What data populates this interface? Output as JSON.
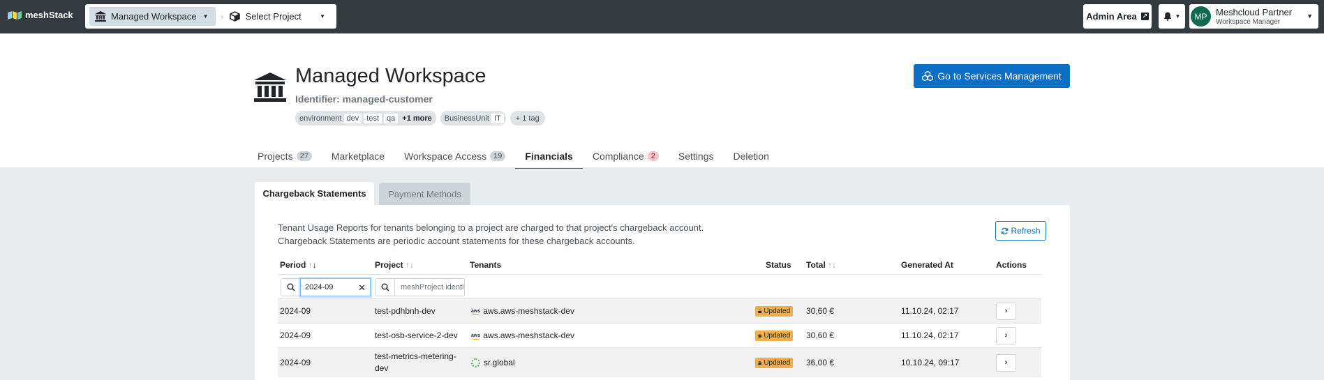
{
  "topbar": {
    "logo_text": "meshStack",
    "breadcrumb": {
      "workspace": "Managed Workspace",
      "project": "Select Project"
    },
    "admin_label": "Admin Area",
    "user": {
      "initials": "MP",
      "name": "Meshcloud Partner",
      "role": "Workspace Manager"
    }
  },
  "workspace": {
    "title": "Managed Workspace",
    "identifier": "Identifier: managed-customer",
    "tags": {
      "environment_key": "environment",
      "environment_values": [
        "dev",
        "test",
        "qa"
      ],
      "environment_more": "+1 more",
      "bu_key": "BusinessUnit",
      "bu_value": "IT",
      "extra": "+ 1 tag"
    },
    "services_button": "Go to Services Management"
  },
  "tabs": [
    {
      "label": "Projects",
      "count": "27"
    },
    {
      "label": "Marketplace"
    },
    {
      "label": "Workspace Access",
      "count": "19"
    },
    {
      "label": "Financials",
      "active": true
    },
    {
      "label": "Compliance",
      "count": "2"
    },
    {
      "label": "Settings"
    },
    {
      "label": "Deletion"
    }
  ],
  "subtabs": {
    "chargeback": "Chargeback Statements",
    "payment": "Payment Methods"
  },
  "description": {
    "line1": "Tenant Usage Reports for tenants belonging to a project are charged to that project's chargeback account.",
    "line2": "Chargeback Statements are periodic account statements for these chargeback accounts."
  },
  "refresh_label": "Refresh",
  "table": {
    "headers": {
      "period": "Period",
      "project": "Project",
      "tenants": "Tenants",
      "status": "Status",
      "total": "Total",
      "generated": "Generated At",
      "actions": "Actions"
    },
    "filters": {
      "period_value": "2024-09",
      "project_placeholder": "meshProject identifier"
    },
    "rows": [
      {
        "period": "2024-09",
        "project": "test-pdhbnh-dev",
        "tenant": "aws.aws-meshstack-dev",
        "tenant_icon": "aws-icon",
        "status": "Updated",
        "total": "30,60 €",
        "generated": "11.10.24, 02:17"
      },
      {
        "period": "2024-09",
        "project": "test-osb-service-2-dev",
        "tenant": "aws.aws-meshstack-dev",
        "tenant_icon": "aws-icon",
        "status": "Updated",
        "total": "30,60 €",
        "generated": "11.10.24, 02:17"
      },
      {
        "period": "2024-09",
        "project_line1": "test-metrics-metering-",
        "project_line2": "dev",
        "tenant": "sr.global",
        "tenant_icon": "service-registry-icon",
        "status": "Updated",
        "total": "36,00 €",
        "generated": "10.10.24, 09:17"
      }
    ]
  },
  "colors": {
    "primary": "#0b6fc6",
    "topbar": "#343a40",
    "status_badge": "#f0ad4e"
  }
}
